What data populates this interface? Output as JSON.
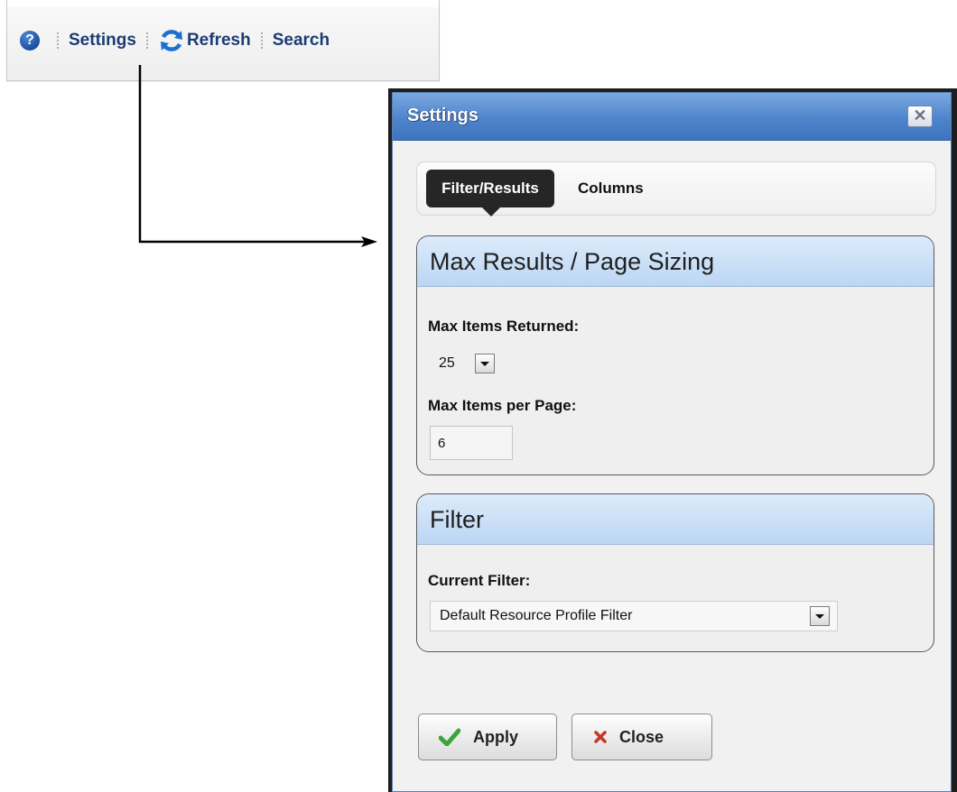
{
  "toolbar": {
    "help_icon": "help-circle-icon",
    "help_glyph": "?",
    "settings_label": "Settings",
    "refresh_label": "Refresh",
    "refresh_icon": "refresh-icon",
    "search_label": "Search"
  },
  "dialog": {
    "title": "Settings",
    "close_glyph": "✕",
    "tabs": [
      {
        "label": "Filter/Results",
        "active": true
      },
      {
        "label": "Columns",
        "active": false
      }
    ],
    "max_results": {
      "header": "Max Results / Page Sizing",
      "items_returned_label": "Max Items Returned:",
      "items_returned_value": "25",
      "items_per_page_label": "Max Items per Page:",
      "items_per_page_value": "6"
    },
    "filter": {
      "header": "Filter",
      "current_filter_label": "Current Filter:",
      "current_filter_value": "Default Resource Profile Filter"
    },
    "buttons": {
      "apply_label": "Apply",
      "apply_icon": "checkmark-icon",
      "close_label": "Close",
      "close_icon": "x-mark-icon"
    }
  },
  "colors": {
    "titlebar": "#4f84cc",
    "section_header": "#c8dcf5",
    "toolbar_text": "#1c3c73",
    "check_green": "#3aa53a",
    "x_red": "#c0392b"
  }
}
